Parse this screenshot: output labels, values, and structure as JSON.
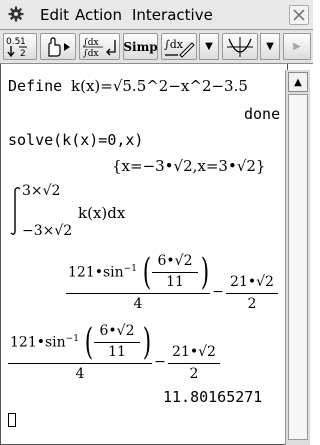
{
  "menu": {
    "items": [
      "Edit",
      "Action",
      "Interactive"
    ]
  },
  "toolbar": {
    "fraction_button": {
      "top": "0.5",
      "bottom": "1/2"
    },
    "simp_label": "Simp"
  },
  "worksheet": {
    "define_label": "Define",
    "define_expr": "k(x)=√5.5^2−x^2−3.5",
    "done": "done",
    "solve_expr": "solve(k(x)=0,x)",
    "solve_result": "{x=−3•√2,x=3•√2}",
    "integral_upper": "3×√2",
    "integral_lower": "−3×√2",
    "integrand": "k(x)dx",
    "frac1_num_coef": "121•sin",
    "frac1_inv": "−1",
    "inner_num": "6•√2",
    "inner_den": "11",
    "frac1_den": "4",
    "minus": "−",
    "frac2_num": "21•√2",
    "frac2_den": "2",
    "decimal_result": "11.80165271"
  }
}
